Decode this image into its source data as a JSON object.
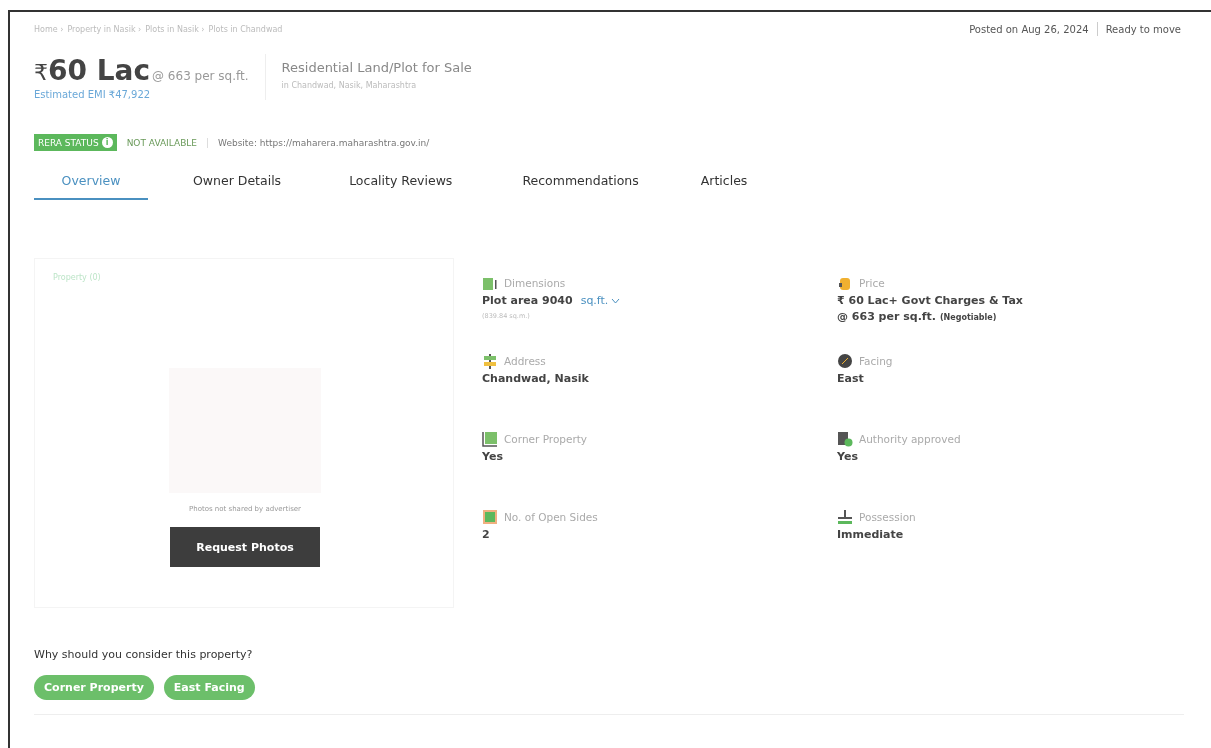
{
  "breadcrumbs": [
    "Home",
    "Property in Nasik",
    "Plots in Nasik",
    "Plots in Chandwad"
  ],
  "crumb_separator": "›",
  "posted": "Posted on Aug 26, 2024",
  "status": "Ready to move",
  "price": {
    "symbol": "₹",
    "amount": "60 Lac",
    "rate": "@ 663 per sq.ft.",
    "emi": "Estimated EMI ₹47,922"
  },
  "title": "Residential Land/Plot for Sale",
  "location": "in Chandwad, Nasik, Maharashtra",
  "rera": {
    "label": "RERA STATUS",
    "info": "i",
    "value": "NOT AVAILABLE",
    "website": "Website: https://maharera.maharashtra.gov.in/"
  },
  "tabs": [
    {
      "label": "Overview",
      "selected": true
    },
    {
      "label": "Owner Details",
      "selected": false
    },
    {
      "label": "Locality Reviews",
      "selected": false
    },
    {
      "label": "Recommendations",
      "selected": false
    },
    {
      "label": "Articles",
      "selected": false
    }
  ],
  "gallery": {
    "tab": "Property (0)",
    "note": "Photos not shared by advertiser",
    "button": "Request Photos"
  },
  "details": [
    {
      "kind": "dimensions",
      "label": "Dimensions",
      "value": "Plot area 9040",
      "unit": "sq.ft.",
      "sub": "(839.84 sq.m.)"
    },
    {
      "kind": "price",
      "label": "Price",
      "value": "₹ 60 Lac+ Govt Charges & Tax",
      "value2": "@ 663 per sq.ft.",
      "note": "(Negotiable)"
    },
    {
      "kind": "address",
      "label": "Address",
      "value": "Chandwad, Nasik"
    },
    {
      "kind": "facing",
      "label": "Facing",
      "value": "East"
    },
    {
      "kind": "corner",
      "label": "Corner Property",
      "value": "Yes"
    },
    {
      "kind": "authority",
      "label": "Authority approved",
      "value": "Yes"
    },
    {
      "kind": "sides",
      "label": "No. of Open Sides",
      "value": "2"
    },
    {
      "kind": "possession",
      "label": "Possession",
      "value": "Immediate"
    }
  ],
  "why": {
    "title": "Why should you consider this property?",
    "chips": [
      "Corner Property",
      "East Facing"
    ]
  }
}
